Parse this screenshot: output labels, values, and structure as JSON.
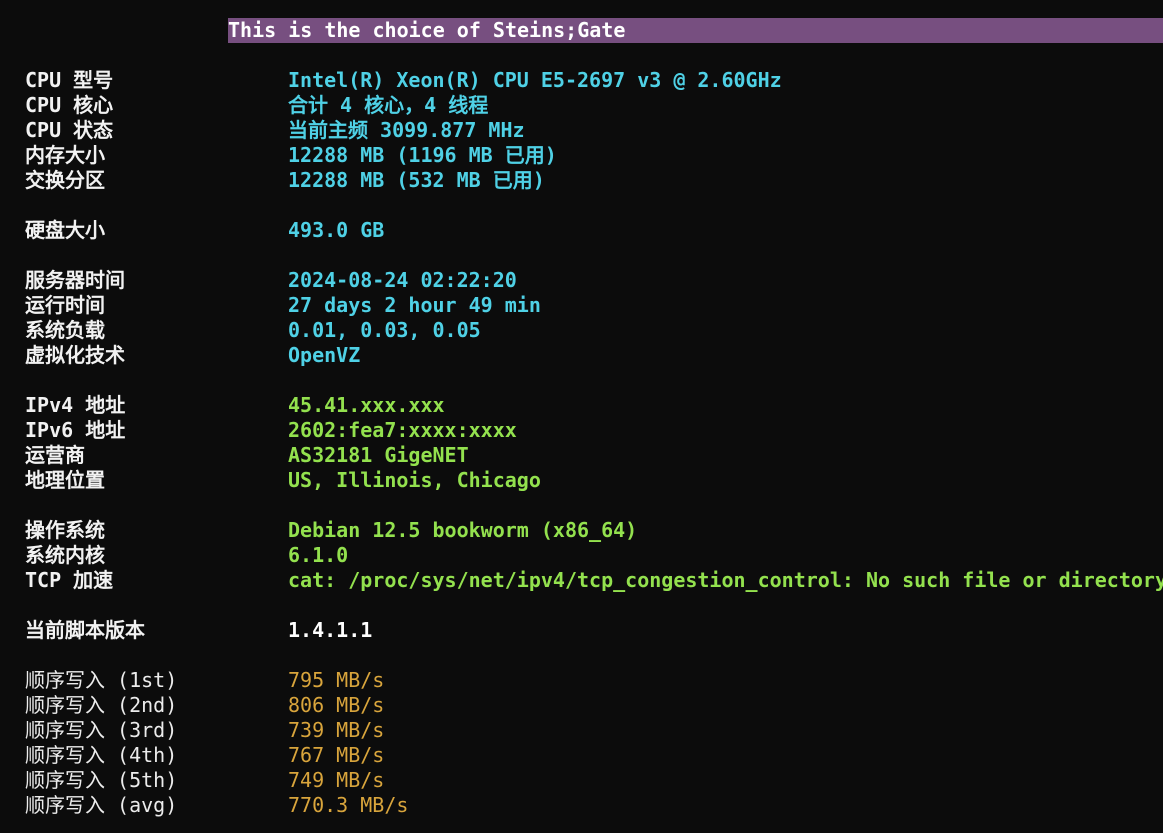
{
  "banner": "This is the choice of Steins;Gate",
  "system": {
    "cpu_model": {
      "label": "CPU 型号",
      "value": "Intel(R) Xeon(R) CPU E5-2697 v3 @ 2.60GHz"
    },
    "cpu_cores": {
      "label": "CPU 核心",
      "value": "合计 4 核心，4 线程"
    },
    "cpu_status": {
      "label": "CPU 状态",
      "value": "当前主频 3099.877 MHz"
    },
    "memory": {
      "label": "内存大小",
      "value": "12288 MB (1196 MB 已用)"
    },
    "swap": {
      "label": "交换分区",
      "value": "12288 MB (532 MB 已用)"
    },
    "disk": {
      "label": "硬盘大小",
      "value": "493.0 GB"
    },
    "server_time": {
      "label": "服务器时间",
      "value": "2024-08-24 02:22:20"
    },
    "uptime": {
      "label": "运行时间",
      "value": "27 days 2 hour 49 min"
    },
    "load": {
      "label": "系统负载",
      "value": "0.01, 0.03, 0.05"
    },
    "virtualization": {
      "label": "虚拟化技术",
      "value": "OpenVZ"
    }
  },
  "network": {
    "ipv4": {
      "label": "IPv4 地址",
      "value": "45.41.xxx.xxx"
    },
    "ipv6": {
      "label": "IPv6 地址",
      "value": "2602:fea7:xxxx:xxxx"
    },
    "isp": {
      "label": "运营商",
      "value": "AS32181 GigeNET"
    },
    "location": {
      "label": "地理位置",
      "value": "US, Illinois, Chicago"
    }
  },
  "os": {
    "os": {
      "label": "操作系统",
      "value": "Debian 12.5 bookworm (x86_64)"
    },
    "kernel": {
      "label": "系统内核",
      "value": "6.1.0"
    },
    "tcp": {
      "label": "TCP 加速",
      "value": "cat: /proc/sys/net/ipv4/tcp_congestion_control: No such file or directory"
    }
  },
  "script": {
    "label": "当前脚本版本",
    "value": "1.4.1.1"
  },
  "disk_writes": [
    {
      "label": "顺序写入 (1st)",
      "value": "795 MB/s"
    },
    {
      "label": "顺序写入 (2nd)",
      "value": "806 MB/s"
    },
    {
      "label": "顺序写入 (3rd)",
      "value": "739 MB/s"
    },
    {
      "label": "顺序写入 (4th)",
      "value": "767 MB/s"
    },
    {
      "label": "顺序写入 (5th)",
      "value": "749 MB/s"
    },
    {
      "label": "顺序写入 (avg)",
      "value": "770.3 MB/s"
    }
  ],
  "colors": {
    "background": "#0c0c0c",
    "banner": "#774f80",
    "cyan": "#4fd1e6",
    "green": "#93e14e",
    "orange": "#d9a53c",
    "white": "#ffffff"
  }
}
